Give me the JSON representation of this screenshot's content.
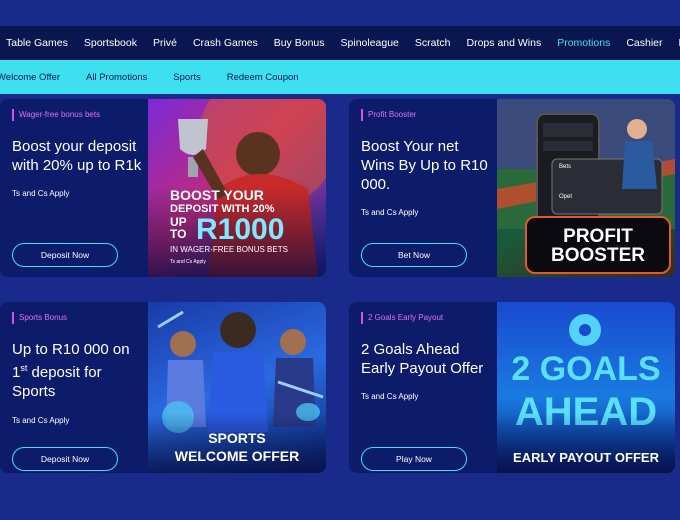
{
  "topnav": {
    "items": [
      "Table Games",
      "Sportsbook",
      "Privé",
      "Crash Games",
      "Buy Bonus",
      "Spinoleague",
      "Scratch",
      "Drops and Wins",
      "Promotions",
      "Cashier",
      "My Ac"
    ],
    "active": "Promotions"
  },
  "subnav": {
    "items": [
      "Welcome Offer",
      "All Promotions",
      "Sports",
      "Redeem Coupon"
    ]
  },
  "cards": [
    {
      "tag": "Wager-free bonus bets",
      "title": "Boost your deposit with 20% up to R1k",
      "tc": "Ts and Cs Apply",
      "button": "Deposit Now",
      "art": {
        "line1": "BOOST YOUR",
        "line2": "DEPOSIT WITH 20%",
        "line3": "UP",
        "line4": "TO",
        "amount": "R1000",
        "line5": "IN WAGER-FREE BONUS BETS",
        "fine": "Ts and Cs Apply"
      }
    },
    {
      "tag": "Profit Booster",
      "title": "Boost Your net Wins By Up to R10 000.",
      "tc": "Ts and Cs Apply",
      "button": "Bet Now",
      "art": {
        "line1": "PROFIT",
        "line2": "BOOSTER",
        "phone_label": "Bets",
        "phone_row": "Opet"
      }
    },
    {
      "tag": "Sports Bonus",
      "title_part1": "Up to R10 000 on 1",
      "title_sup": "st",
      "title_part2": " deposit for Sports",
      "tc": "Ts and Cs Apply",
      "button": "Deposit Now",
      "art": {
        "line1": "SPORTS",
        "line2": "WELCOME OFFER"
      }
    },
    {
      "tag": "2 Goals Early Payout",
      "title": "2 Goals Ahead Early Payout Offer",
      "tc": "Ts and Cs Apply",
      "button": "Play Now",
      "art": {
        "line1": "2 GOALS",
        "line2": "AHEAD",
        "line3": "EARLY PAYOUT OFFER"
      }
    }
  ],
  "colors": {
    "accent": "#3ee0f0",
    "tag": "#e070f5",
    "card_bg": "#0d1b6b",
    "page_bg": "#1a2a8a"
  }
}
